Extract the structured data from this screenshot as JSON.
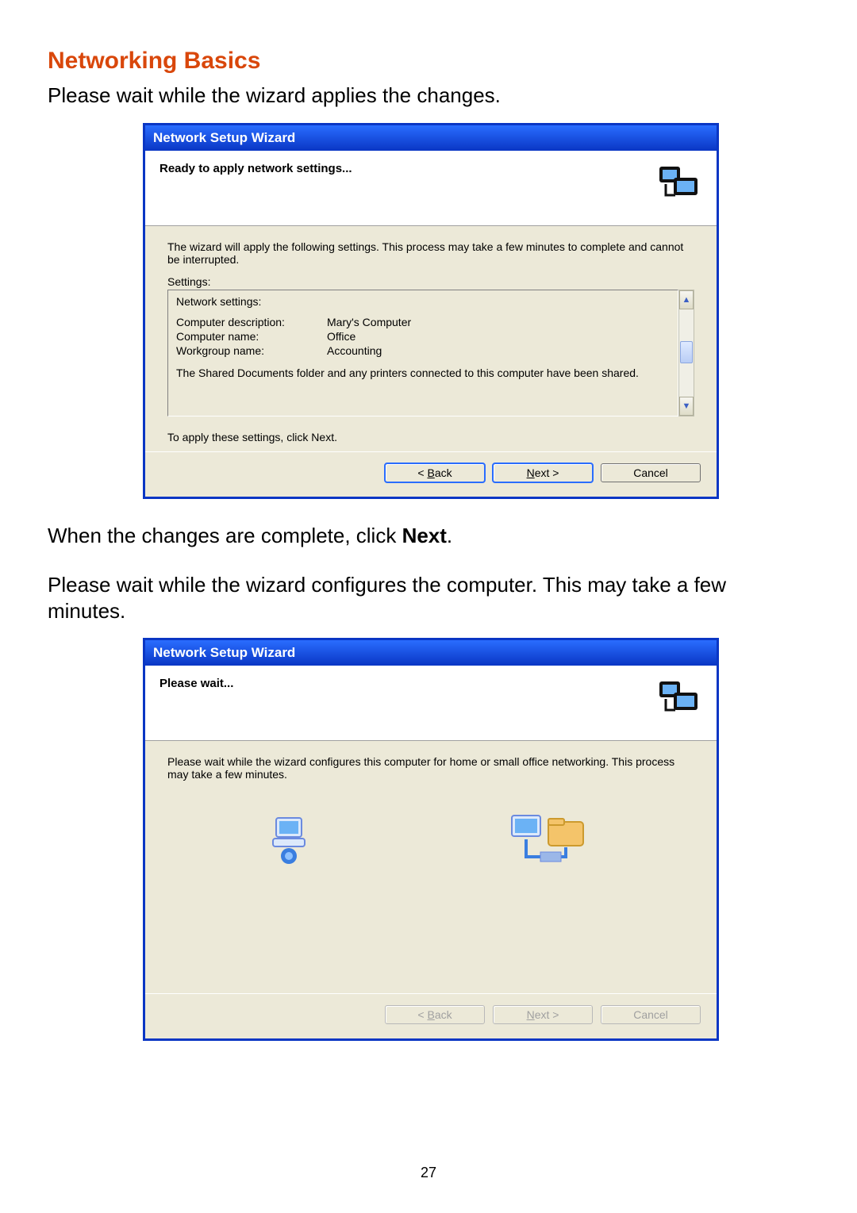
{
  "page": {
    "title": "Networking Basics",
    "intro1": "Please wait while the wizard applies the changes.",
    "mid1_a": "When the changes are complete, click ",
    "mid1_bold": "Next",
    "mid1_b": ".",
    "mid2": "Please wait while the wizard configures the computer. This may take a few minutes.",
    "number": "27"
  },
  "wizard1": {
    "title": "Network Setup Wizard",
    "heading": "Ready to apply network settings...",
    "body_intro": "The wizard will apply the following settings. This process may take a few minutes to complete and cannot be interrupted.",
    "settings_label": "Settings:",
    "settings": {
      "header": "Network settings:",
      "rows": [
        {
          "k": "Computer description:",
          "v": "Mary's Computer"
        },
        {
          "k": "Computer name:",
          "v": "Office"
        },
        {
          "k": "Workgroup name:",
          "v": "Accounting"
        }
      ],
      "footer": "The Shared Documents folder and any printers connected to this computer have been shared."
    },
    "apply_hint": "To apply these settings, click Next.",
    "buttons": {
      "back_prefix": "< ",
      "back_u": "B",
      "back_rest": "ack",
      "next_u": "N",
      "next_rest": "ext >",
      "cancel": "Cancel"
    }
  },
  "wizard2": {
    "title": "Network Setup Wizard",
    "heading": "Please wait...",
    "body": "Please wait while the wizard configures this computer for home or small office networking. This process may take a few minutes.",
    "buttons": {
      "back_prefix": "< ",
      "back_u": "B",
      "back_rest": "ack",
      "next_u": "N",
      "next_rest": "ext >",
      "cancel": "Cancel"
    }
  }
}
